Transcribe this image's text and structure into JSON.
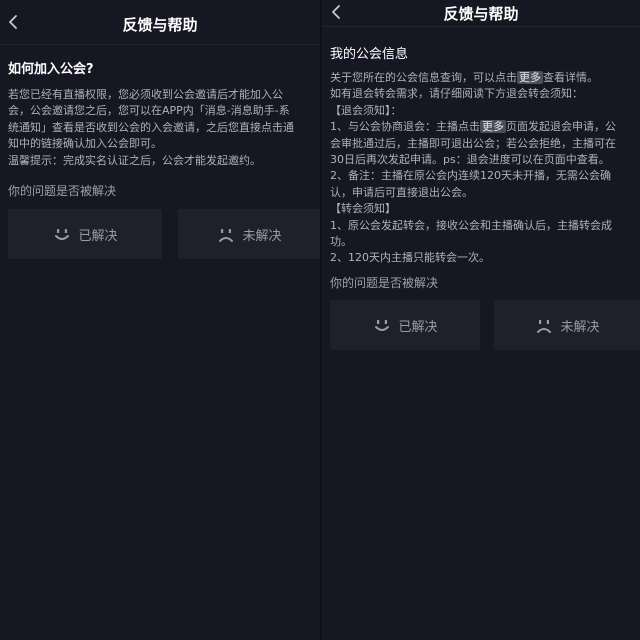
{
  "left": {
    "header": {
      "title": "反馈与帮助"
    },
    "heading": "如何加入公会?",
    "lines": [
      "若您已经有直播权限，您必须收到公会邀请后才能加入公",
      "会，公会邀请您之后，您可以在APP内「消息-消息助手-系",
      "统通知」查看是否收到公会的入会邀请，之后您直接点击通",
      "知中的链接确认加入公会即可。",
      "温馨提示：完成实名认证之后，公会才能发起邀约。"
    ],
    "question": "你的问题是否被解决",
    "resolved_label": "已解决",
    "unresolved_label": "未解决"
  },
  "right": {
    "header": {
      "title": "反馈与帮助"
    },
    "heading": "我的公会信息",
    "line1_pre": "关于您所在的公会信息查询，可以点击",
    "line1_pill": "更多",
    "line1_post": "查看详情。",
    "line2": "如有退会转会需求，请仔细阅读下方退会转会须知：",
    "line3": "【退会须知】：",
    "line4_pre": "1、与公会协商退会：主播点击",
    "line4_pill": "更多",
    "line4_post": "页面发起退会申请，公",
    "line5": "会审批通过后，主播即可退出公会；若公会拒绝，主播可在",
    "line6": "30日后再次发起申请。ps：退会进度可以在页面中查看。",
    "line7": "2、备注：主播在原公会内连续120天未开播，无需公会确",
    "line8": "认，申请后可直接退出公会。",
    "line9": "【转会须知】",
    "line10": "1、原公会发起转会，接收公会和主播确认后，主播转会成",
    "line11": "功。",
    "line12": "2、120天内主播只能转会一次。",
    "question": "你的问题是否被解决",
    "resolved_label": "已解决",
    "unresolved_label": "未解决"
  },
  "icons": {
    "back": "chevron-left-icon",
    "resolved": "smile-icon",
    "unresolved": "frown-icon"
  }
}
